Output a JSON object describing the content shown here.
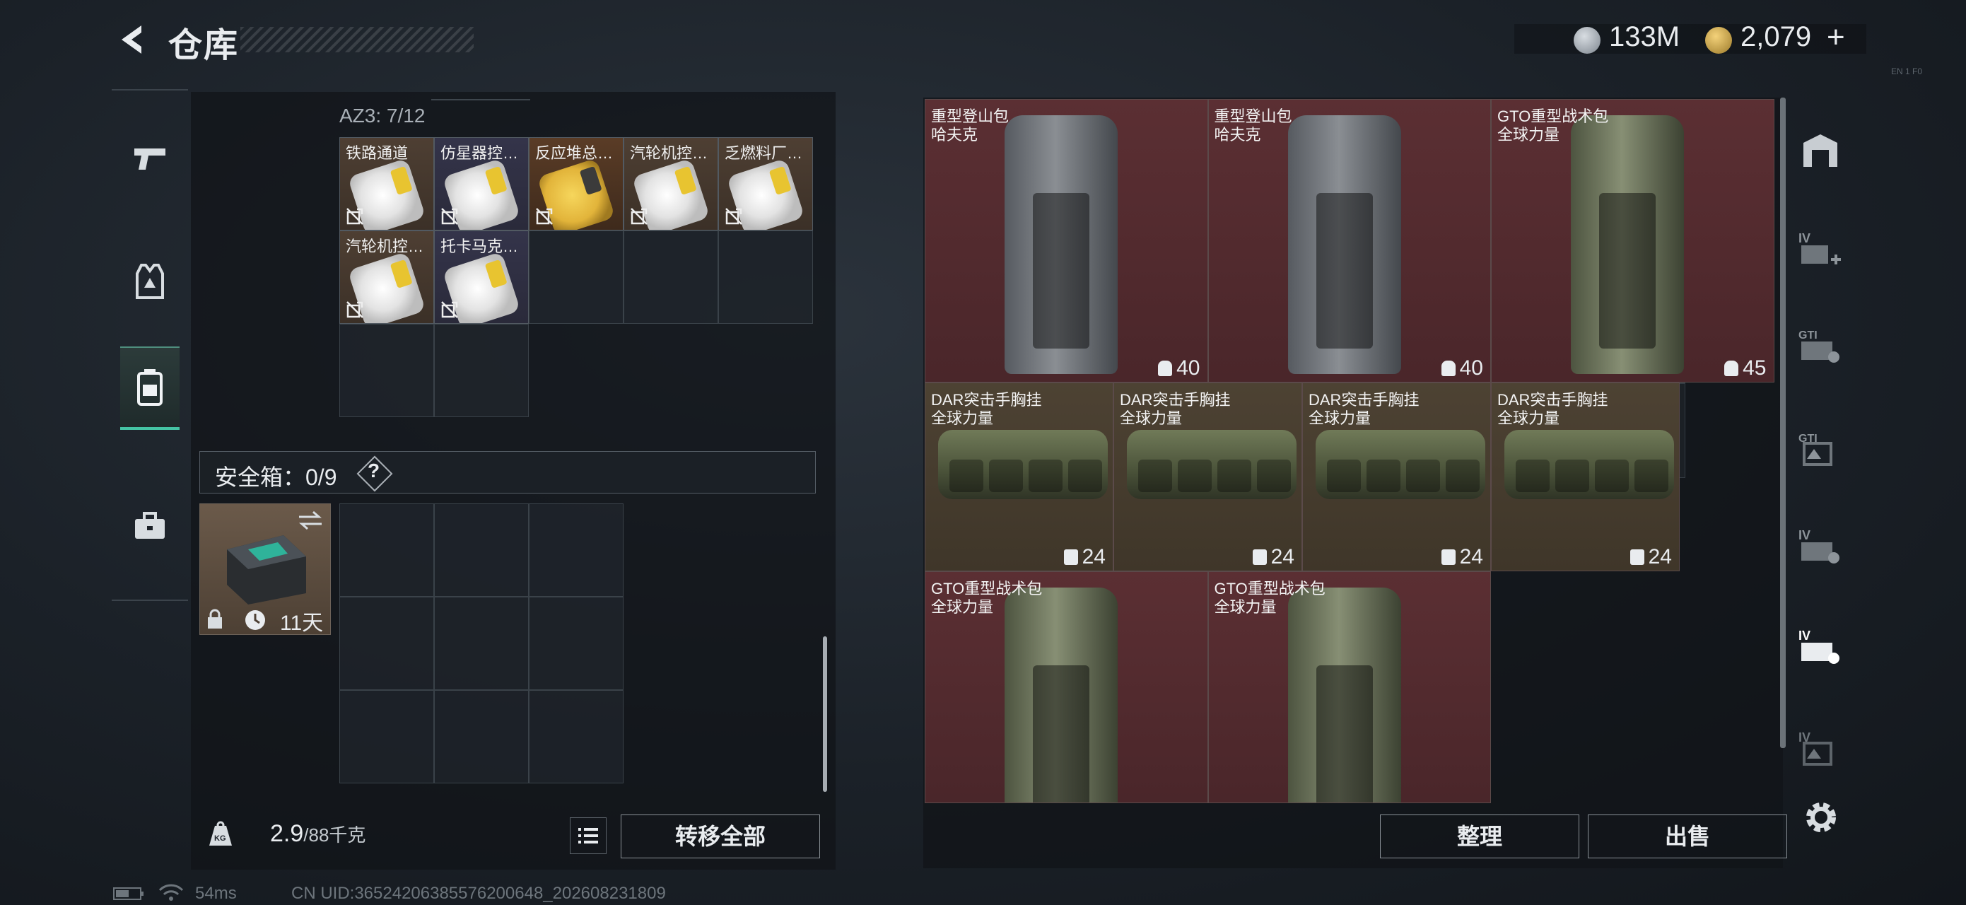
{
  "header": {
    "title": "仓库",
    "currency1": "133M",
    "currency2": "2,079",
    "add_symbol": "+",
    "version_hint": "EN 1 F0"
  },
  "nav": {
    "items": [
      {
        "name": "weapon",
        "icon": "pistol-icon"
      },
      {
        "name": "armor",
        "icon": "vest-icon"
      },
      {
        "name": "backpack",
        "icon": "backpack-icon",
        "active": true
      },
      {
        "name": "case",
        "icon": "briefcase-icon"
      }
    ]
  },
  "container": {
    "label": "AZ3: 7/12",
    "items": [
      {
        "name": "铁路通道",
        "style": "white"
      },
      {
        "name": "仿星器控…",
        "style": "white"
      },
      {
        "name": "反应堆总…",
        "style": "gold"
      },
      {
        "name": "汽轮机控…",
        "style": "white"
      },
      {
        "name": "乏燃料厂…",
        "style": "white"
      },
      {
        "name": "汽轮机控…",
        "style": "white"
      },
      {
        "name": "托卡马克…",
        "style": "white"
      }
    ]
  },
  "safe": {
    "label": "安全箱：0/9",
    "help": "?",
    "days": "11天"
  },
  "footer": {
    "weight": "2.9",
    "weight_cap": "/88千克",
    "transfer_label": "转移全部"
  },
  "stash": {
    "items": [
      {
        "line1": "重型登山包",
        "line2": "哈夫克",
        "count": "40",
        "color": "red",
        "kind": "grey-pack"
      },
      {
        "line1": "重型登山包",
        "line2": "哈夫克",
        "count": "40",
        "color": "red",
        "kind": "grey-pack"
      },
      {
        "line1": "GTO重型战术包",
        "line2": "全球力量",
        "count": "45",
        "color": "red",
        "kind": "olive-pack"
      },
      {
        "line1": "DAR突击手胸挂",
        "line2": "全球力量",
        "count": "24",
        "color": "brown",
        "kind": "rig"
      },
      {
        "line1": "DAR突击手胸挂",
        "line2": "全球力量",
        "count": "24",
        "color": "brown",
        "kind": "rig"
      },
      {
        "line1": "DAR突击手胸挂",
        "line2": "全球力量",
        "count": "24",
        "color": "brown",
        "kind": "rig"
      },
      {
        "line1": "DAR突击手胸挂",
        "line2": "全球力量",
        "count": "24",
        "color": "brown",
        "kind": "rig"
      },
      {
        "line1": "GTO重型战术包",
        "line2": "全球力量",
        "count": "",
        "color": "red",
        "kind": "olive-pack"
      },
      {
        "line1": "GTO重型战术包",
        "line2": "全球力量",
        "count": "",
        "color": "red",
        "kind": "olive-pack"
      }
    ],
    "sort_label": "整理",
    "sell_label": "出售"
  },
  "right_tabs": [
    "warehouse-icon",
    "stash-iv-add-icon",
    "stash-gti-icon",
    "stash-gti-2-icon",
    "stash-iv-icon",
    "stash-iv-selected-icon",
    "stash-iv-3-icon"
  ],
  "status": {
    "ping": "54ms",
    "uid": "CN UID:3652420638557620064​8_202608231809"
  },
  "colors": {
    "accent": "#45c4a4",
    "red_item": "#5b2f33",
    "brown_item": "#4d4233"
  }
}
